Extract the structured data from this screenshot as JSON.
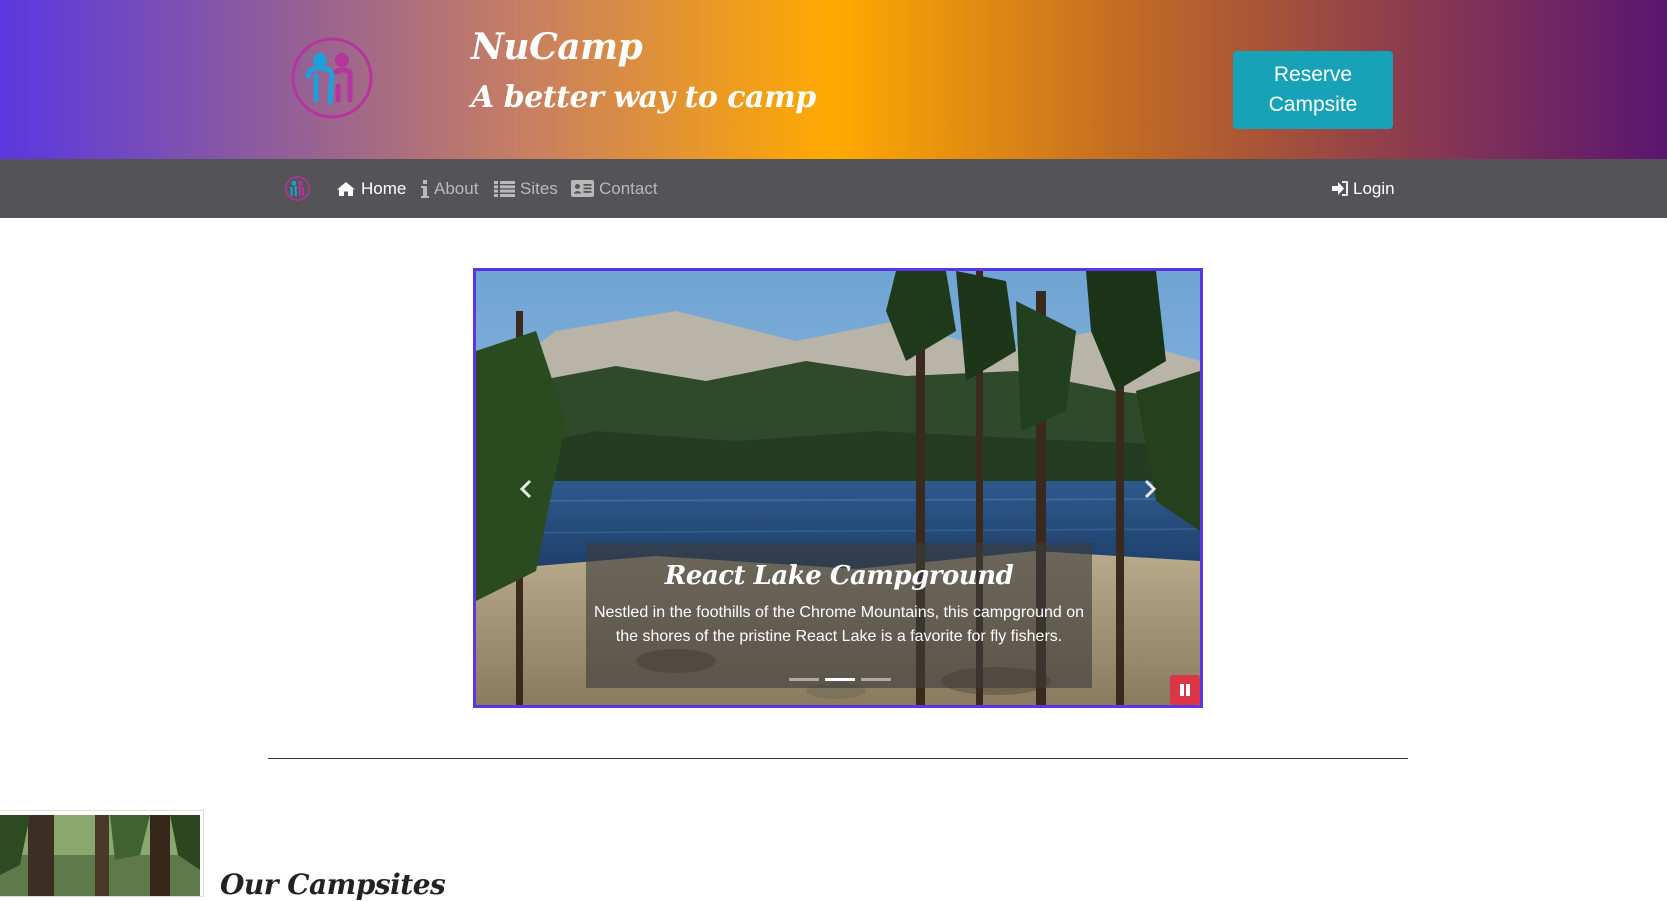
{
  "header": {
    "title": "NuCamp",
    "tagline": "A better way to camp",
    "reserve_button": "Reserve Campsite",
    "logo": "nucamp-logo"
  },
  "navbar": {
    "items": [
      {
        "label": "Home",
        "icon": "home-icon",
        "active": true
      },
      {
        "label": "About",
        "icon": "info-icon",
        "active": false
      },
      {
        "label": "Sites",
        "icon": "list-icon",
        "active": false
      },
      {
        "label": "Contact",
        "icon": "address-card-icon",
        "active": false
      }
    ],
    "login": {
      "label": "Login",
      "icon": "sign-in-icon"
    }
  },
  "carousel": {
    "slide_title": "React Lake Campground",
    "slide_text": "Nestled in the foothills of the Chrome Mountains, this campground on the shores of the pristine React Lake is a favorite for fly fishers.",
    "slide_count": 3,
    "active_index": 1,
    "border_color": "#5a37e0"
  },
  "section": {
    "title": "Our Campsites"
  },
  "colors": {
    "reserve_button": "#17a2b8",
    "navbar": "#545357",
    "pause_button": "#dc3545"
  }
}
